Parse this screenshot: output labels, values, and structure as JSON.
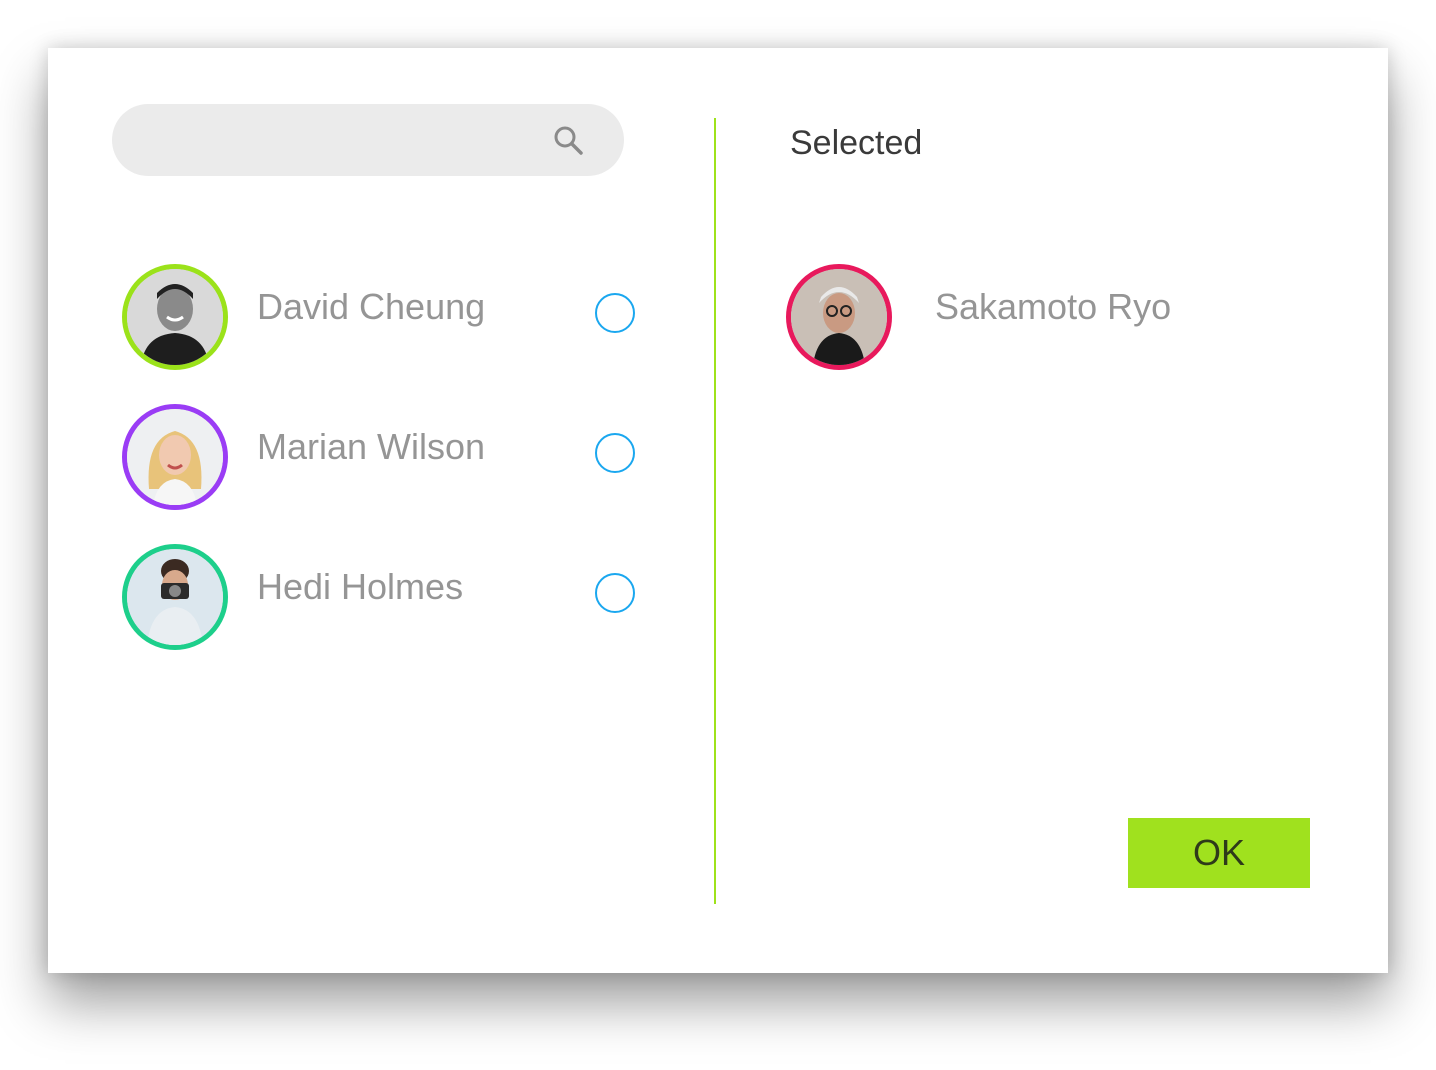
{
  "search": {
    "value": "",
    "placeholder": "",
    "icon": "search-icon"
  },
  "contacts": [
    {
      "name": "David Cheung",
      "ring_color": "#9be21a",
      "checked": false
    },
    {
      "name": "Marian Wilson",
      "ring_color": "#9a3cf5",
      "checked": false
    },
    {
      "name": "Hedi Holmes",
      "ring_color": "#1dcf8b",
      "checked": false
    }
  ],
  "selected": {
    "title": "Selected",
    "items": [
      {
        "name": "Sakamoto Ryo",
        "ring_color": "#e8195c"
      }
    ]
  },
  "ok_label": "OK",
  "colors": {
    "accent": "#a0e11e",
    "divider": "#9ee21b",
    "radio": "#1aa7ef",
    "search_bg": "#ebebeb",
    "name_text": "#959595"
  }
}
